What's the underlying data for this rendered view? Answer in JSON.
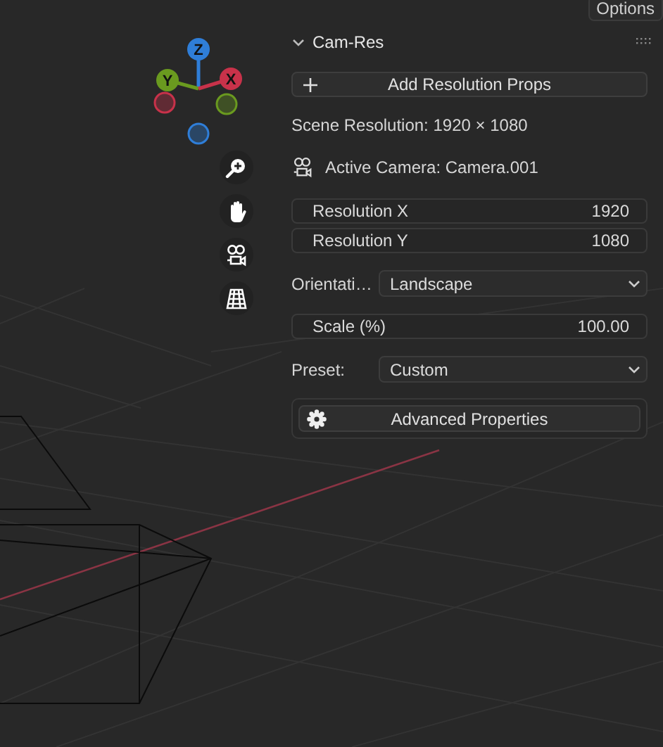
{
  "header": {
    "options_button": "Options"
  },
  "gizmo": {
    "axes": [
      {
        "kind": "positive",
        "label": "Z",
        "color": "#2f7ed8"
      },
      {
        "kind": "positive",
        "label": "Y",
        "color": "#6a9a1f"
      },
      {
        "kind": "positive",
        "label": "X",
        "color": "#c8324a"
      },
      {
        "kind": "negative",
        "color": "#c8324a"
      },
      {
        "kind": "negative",
        "color": "#6a9a1f"
      },
      {
        "kind": "negative",
        "color": "#2f7ed8"
      }
    ]
  },
  "panel": {
    "title": "Cam-Res",
    "expanded": true,
    "items": [
      {
        "kind": "add-button",
        "label": "Add Resolution Props"
      },
      {
        "kind": "info",
        "text": "Scene Resolution: 1920 × 1080"
      },
      {
        "kind": "camera-info",
        "text": "Active Camera: Camera.001"
      },
      {
        "kind": "number-group",
        "fields": [
          {
            "label": "Resolution X",
            "value": "1920"
          },
          {
            "label": "Resolution Y",
            "value": "1080"
          }
        ]
      },
      {
        "kind": "dropdown",
        "label": "Orientati…",
        "value": "Landscape"
      },
      {
        "kind": "number-group",
        "fields": [
          {
            "label": "Scale (%)",
            "value": "100.00"
          }
        ]
      },
      {
        "kind": "dropdown",
        "label": "Preset:",
        "value": "Custom"
      },
      {
        "kind": "settings-button",
        "label": "Advanced Properties"
      }
    ]
  }
}
